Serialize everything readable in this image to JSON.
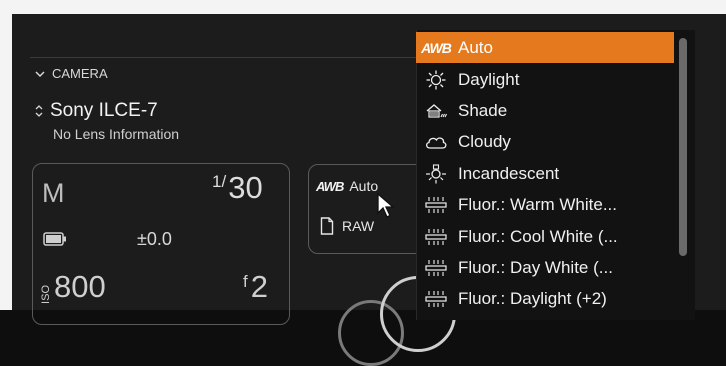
{
  "camera": {
    "section_title": "CAMERA",
    "name": "Sony ILCE-7",
    "lens": "No Lens Information",
    "mode": "M",
    "shutter_num": "1",
    "shutter_den": "30",
    "exposure": "±0.0",
    "iso_label": "ISO",
    "iso_value": "800",
    "f_label": "f",
    "aperture": "2"
  },
  "white_balance": {
    "awb_glyph": "AWB",
    "current": "Auto",
    "format": "RAW"
  },
  "wb_menu": {
    "selected_index": 0,
    "accent_color": "#e47a1d",
    "items": [
      {
        "label": "Auto",
        "icon": "awb-icon"
      },
      {
        "label": "Daylight",
        "icon": "sun-icon"
      },
      {
        "label": "Shade",
        "icon": "shade-icon"
      },
      {
        "label": "Cloudy",
        "icon": "cloud-icon"
      },
      {
        "label": "Incandescent",
        "icon": "bulb-icon"
      },
      {
        "label": "Fluor.: Warm White...",
        "icon": "fluorescent-icon"
      },
      {
        "label": "Fluor.: Cool White (...",
        "icon": "fluorescent-icon"
      },
      {
        "label": "Fluor.: Day White (...",
        "icon": "fluorescent-icon"
      },
      {
        "label": "Fluor.: Daylight (+2)",
        "icon": "fluorescent-icon"
      }
    ]
  }
}
